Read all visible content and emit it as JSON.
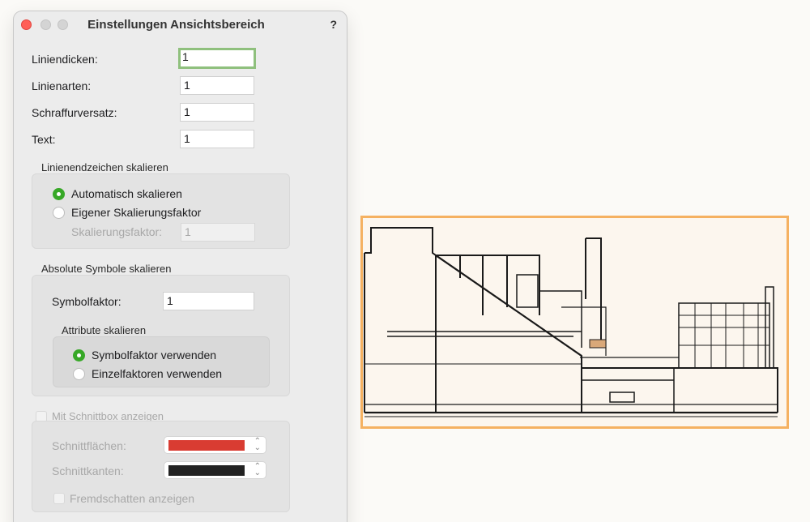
{
  "dialog": {
    "title": "Einstellungen Ansichtsbereich",
    "help": "?",
    "fields": [
      {
        "label": "Liniendicken:",
        "value": "1"
      },
      {
        "label": "Linienarten:",
        "value": "1"
      },
      {
        "label": "Schraffurversatz:",
        "value": "1"
      },
      {
        "label": "Text:",
        "value": "1"
      }
    ],
    "line_end_group": {
      "title": "Linienendzeichen skalieren",
      "options": [
        "Automatisch skalieren",
        "Eigener Skalierungsfaktor"
      ],
      "selected": 0,
      "factor_label": "Skalierungsfaktor:",
      "factor_value": "1"
    },
    "symbol_group": {
      "title": "Absolute Symbole skalieren",
      "factor_label": "Symbolfaktor:",
      "factor_value": "1",
      "attr_title": "Attribute skalieren",
      "attr_options": [
        "Symbolfaktor verwenden",
        "Einzelfaktoren verwenden"
      ],
      "attr_selected": 0
    },
    "section_group": {
      "checkbox_label": "Mit Schnittbox anzeigen",
      "checked": false,
      "faces_label": "Schnittflächen:",
      "faces_color": "#d93c32",
      "edges_label": "Schnittkanten:",
      "edges_color": "#222222",
      "shadow_label": "Fremdschatten anzeigen"
    }
  },
  "colors": {
    "accent_green": "#37a827",
    "focus_ring": "#8fc07d",
    "viewport_border": "#f5b161"
  }
}
